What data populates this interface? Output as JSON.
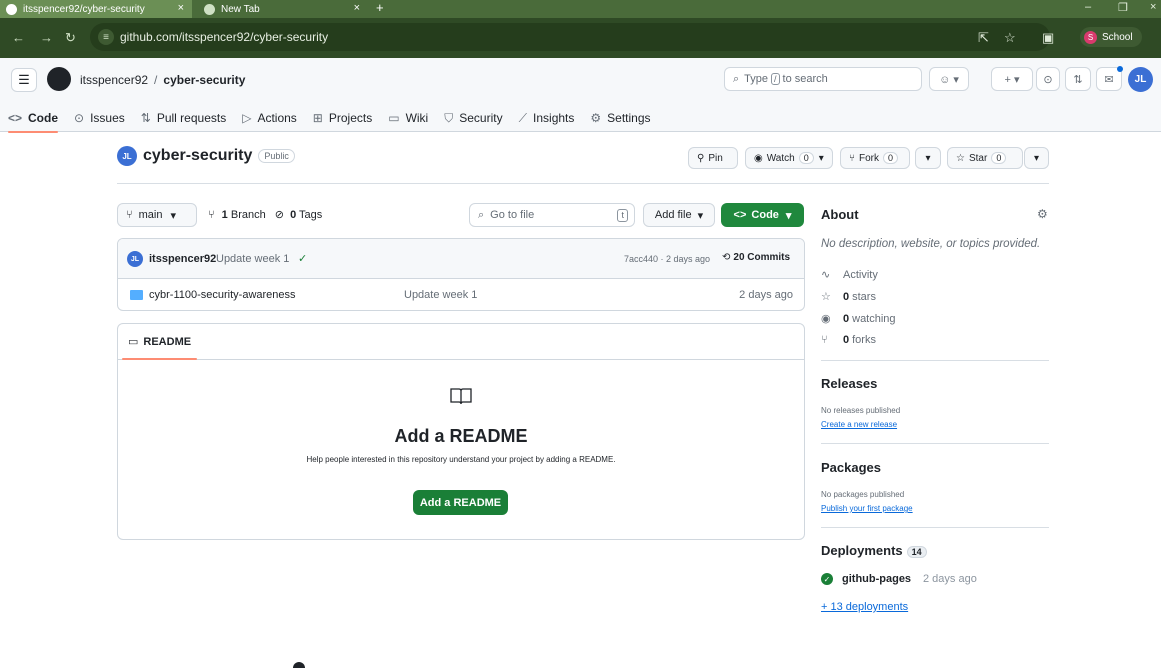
{
  "browser": {
    "tabs": [
      {
        "title": "itsspencer92/cyber-security",
        "close": "×"
      },
      {
        "title": "New Tab",
        "close": "×"
      }
    ],
    "new_tab": "+",
    "url": "github.com/itsspencer92/cyber-security",
    "profile": {
      "initial": "S",
      "label": "School"
    },
    "window_controls": [
      "–",
      "❐",
      "×"
    ]
  },
  "header": {
    "owner": "itsspencer92",
    "separator": "/",
    "repo": "cyber-security",
    "search": {
      "prefix": "Type",
      "key": "/",
      "suffix": "to search"
    }
  },
  "repo_tabs": [
    {
      "icon": "<>",
      "label": "Code"
    },
    {
      "icon": "⊙",
      "label": "Issues"
    },
    {
      "icon": "⇅",
      "label": "Pull requests"
    },
    {
      "icon": "▷",
      "label": "Actions"
    },
    {
      "icon": "⊞",
      "label": "Projects"
    },
    {
      "icon": "▭",
      "label": "Wiki"
    },
    {
      "icon": "⛉",
      "label": "Security"
    },
    {
      "icon": "⟋",
      "label": "Insights"
    },
    {
      "icon": "⚙",
      "label": "Settings"
    }
  ],
  "repo": {
    "avatar_initials": "JL",
    "name": "cyber-security",
    "visibility": "Public",
    "actions": {
      "pin": "Pin",
      "watch": "Watch",
      "watch_count": "0",
      "fork": "Fork",
      "fork_count": "0",
      "star": "Star",
      "star_count": "0"
    }
  },
  "branch_bar": {
    "branch": "main",
    "branch_count": "1",
    "branch_word": "Branch",
    "tag_count": "0",
    "tag_word": "Tags",
    "goto_placeholder": "Go to file",
    "goto_key": "t",
    "add_file": "Add file",
    "code": "Code"
  },
  "last_commit": {
    "user": "itsspencer92",
    "message": "Update week 1",
    "status": "✓",
    "meta": "7acc440 · 2 days ago",
    "commits": "20 Commits"
  },
  "files": [
    {
      "name": "cybr-1100-security-awareness",
      "message": "Update week 1",
      "date": "2 days ago"
    }
  ],
  "readme": {
    "tab": "README",
    "heading": "Add a README",
    "description": "Help people interested in this repository understand your project by adding a README.",
    "button": "Add a README"
  },
  "sidebar": {
    "about_title": "About",
    "description": "No description, website, or topics provided.",
    "activity": "Activity",
    "stars": {
      "count": "0",
      "label": "stars"
    },
    "watching": {
      "count": "0",
      "label": "watching"
    },
    "forks": {
      "count": "0",
      "label": "forks"
    },
    "releases_title": "Releases",
    "releases_none": "No releases published",
    "releases_link": "Create a new release",
    "packages_title": "Packages",
    "packages_none": "No packages published",
    "packages_link": "Publish your first package",
    "deployments_title": "Deployments",
    "deployments_count": "14",
    "deployment": {
      "name": "github-pages",
      "time": "2 days ago"
    },
    "more_deployments": "+ 13 deployments"
  }
}
